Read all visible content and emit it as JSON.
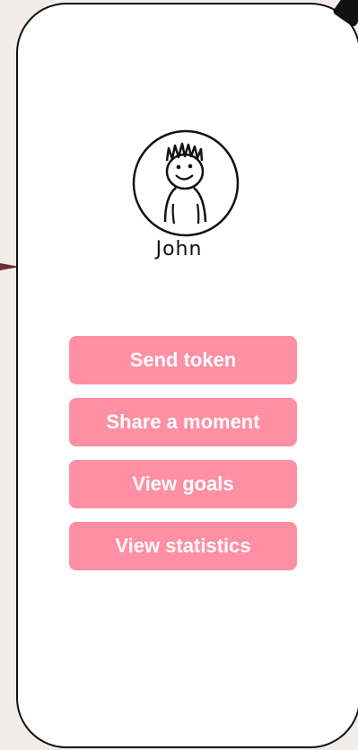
{
  "profile": {
    "name": "John"
  },
  "actions": [
    {
      "label": "Send token"
    },
    {
      "label": "Share a moment"
    },
    {
      "label": "View goals"
    },
    {
      "label": "View statistics"
    }
  ],
  "colors": {
    "button_bg": "#ff8fa3",
    "button_text": "#ffffff",
    "background": "#f4ece9",
    "frame": "#111111"
  },
  "icons": {
    "avatar": "person-sketch-icon",
    "arrow": "arrow-pointer-icon"
  }
}
